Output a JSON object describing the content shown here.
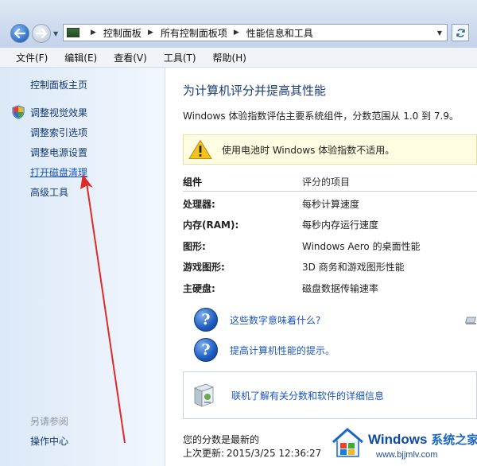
{
  "address_bar": {
    "breadcrumbs": [
      "控制面板",
      "所有控制面板项",
      "性能信息和工具"
    ]
  },
  "menu": [
    "文件(F)",
    "编辑(E)",
    "查看(V)",
    "工具(T)",
    "帮助(H)"
  ],
  "left_panel": {
    "home": "控制面板主页",
    "links": [
      "调整视觉效果",
      "调整索引选项",
      "调整电源设置",
      "打开磁盘清理",
      "高级工具"
    ],
    "see_also_heading": "另请参阅",
    "see_also_link": "操作中心"
  },
  "main": {
    "title": "为计算机评分并提高其性能",
    "description": "Windows 体验指数评估主要系统组件，分数范围从 1.0 到 7.9。",
    "warning": "使用电池时 Windows 体验指数不适用。",
    "table": {
      "headers": [
        "组件",
        "评分的项目"
      ],
      "rows": [
        [
          "处理器:",
          "每秒计算速度"
        ],
        [
          "内存(RAM):",
          "每秒内存运行速度"
        ],
        [
          "图形:",
          "Windows Aero 的桌面性能"
        ],
        [
          "游戏图形:",
          "3D 商务和游戏图形性能"
        ],
        [
          "主硬盘:",
          "磁盘数据传输速率"
        ]
      ]
    },
    "help_links": [
      "这些数字意味着什么?",
      "提高计算机性能的提示。"
    ],
    "online_link": "联机了解有关分数和软件的详细信息",
    "status_line": "您的分数是最新的",
    "last_update_label": "上次更新:",
    "last_update_value": "2015/3/25 12:36:27"
  },
  "watermark": {
    "title": "Windows",
    "title_cn": "系统之家",
    "url": "www.bjjmlv.com"
  },
  "colors": {
    "link": "#1a55c0",
    "title": "#1c3d78",
    "annotation_arrow": "#e02a2a"
  }
}
